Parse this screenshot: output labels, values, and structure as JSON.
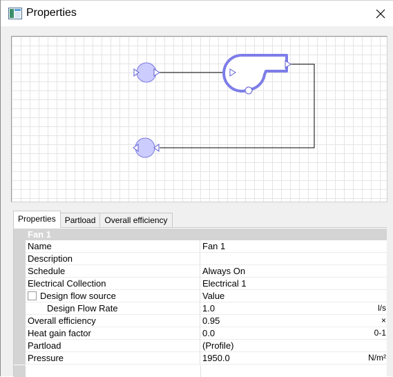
{
  "window": {
    "title": "Properties",
    "icon": "properties-app-icon",
    "close_icon": "close-icon"
  },
  "diagram": {
    "components": [
      "inlet-node",
      "fan",
      "outlet-node"
    ],
    "colors": {
      "node_fill": "#ccccff",
      "node_stroke": "#7b7be0",
      "fan_stroke": "#7d7de8",
      "line": "#000000"
    }
  },
  "tabs": [
    "Properties",
    "Partload",
    "Overall efficiency"
  ],
  "active_tab": "Properties",
  "grid": {
    "category": "Fan 1",
    "rows": [
      {
        "name": "Name",
        "value": "Fan 1",
        "unit": ""
      },
      {
        "name": "Description",
        "value": "",
        "unit": ""
      },
      {
        "name": "Schedule",
        "value": "Always On",
        "unit": ""
      },
      {
        "name": "Electrical Collection",
        "value": "Electrical 1",
        "unit": ""
      },
      {
        "name": "Design flow source",
        "value": "Value",
        "unit": ""
      },
      {
        "name": "Design Flow Rate",
        "value": "1.0",
        "unit": "l/s"
      },
      {
        "name": "Overall efficiency",
        "value": "0.95",
        "unit": "×"
      },
      {
        "name": "Heat gain factor",
        "value": "0.0",
        "unit": "0-1"
      },
      {
        "name": "Partload",
        "value": "(Profile)",
        "unit": ""
      },
      {
        "name": "Pressure",
        "value": "1950.0",
        "unit": "N/m²"
      }
    ]
  }
}
